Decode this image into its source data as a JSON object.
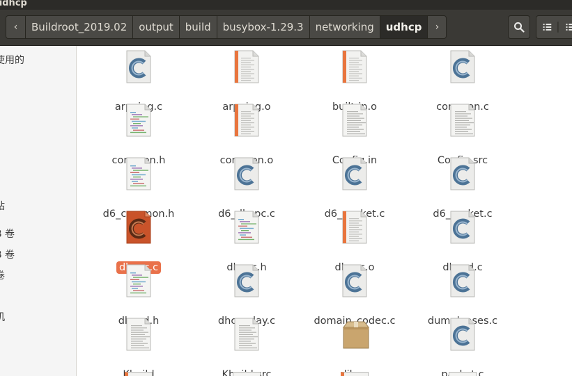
{
  "window": {
    "title": "udhcp"
  },
  "pathbar": {
    "back_glyph": "‹",
    "forward_glyph": "›",
    "crumbs": [
      "Buildroot_2019.02",
      "output",
      "build",
      "busybox-1.29.3",
      "networking",
      "udhcp"
    ]
  },
  "header_icons": {
    "search": "search-icon",
    "view": "list-view-icon"
  },
  "sidebar": {
    "items": [
      "使用的",
      "站",
      "B 卷",
      "B 卷",
      "卷",
      "机"
    ]
  },
  "files": [
    {
      "name": "arpping.c",
      "type": "c"
    },
    {
      "name": "arpping.o",
      "type": "o"
    },
    {
      "name": "built-in.o",
      "type": "o"
    },
    {
      "name": "common.c",
      "type": "c"
    },
    {
      "name": "common.h",
      "type": "h"
    },
    {
      "name": "common.o",
      "type": "o"
    },
    {
      "name": "Config.in",
      "type": "txt"
    },
    {
      "name": "Config.src",
      "type": "txt"
    },
    {
      "name": "d6_common.h",
      "type": "h"
    },
    {
      "name": "d6_dhcpc.c",
      "type": "c"
    },
    {
      "name": "d6_packet.c",
      "type": "c"
    },
    {
      "name": "d6_socket.c",
      "type": "c"
    },
    {
      "name": "dhcpc.c",
      "type": "c-selected"
    },
    {
      "name": "dhcpc.h",
      "type": "h"
    },
    {
      "name": "dhcpc.o",
      "type": "o"
    },
    {
      "name": "dhcpd.c",
      "type": "c"
    },
    {
      "name": "dhcpd.h",
      "type": "h"
    },
    {
      "name": "dhcprelay.c",
      "type": "c"
    },
    {
      "name": "domain_codec.c",
      "type": "c"
    },
    {
      "name": "dumpleases.c",
      "type": "c"
    },
    {
      "name": "Kbuild",
      "type": "txt"
    },
    {
      "name": "Kbuild.src",
      "type": "txt"
    },
    {
      "name": "lib.a",
      "type": "archive"
    },
    {
      "name": "packet.c",
      "type": "c"
    }
  ],
  "selected_file": "dhcpc.c",
  "colors": {
    "accent": "#e9714a",
    "header": "#3a3935",
    "titlebar": "#2c2b28"
  }
}
